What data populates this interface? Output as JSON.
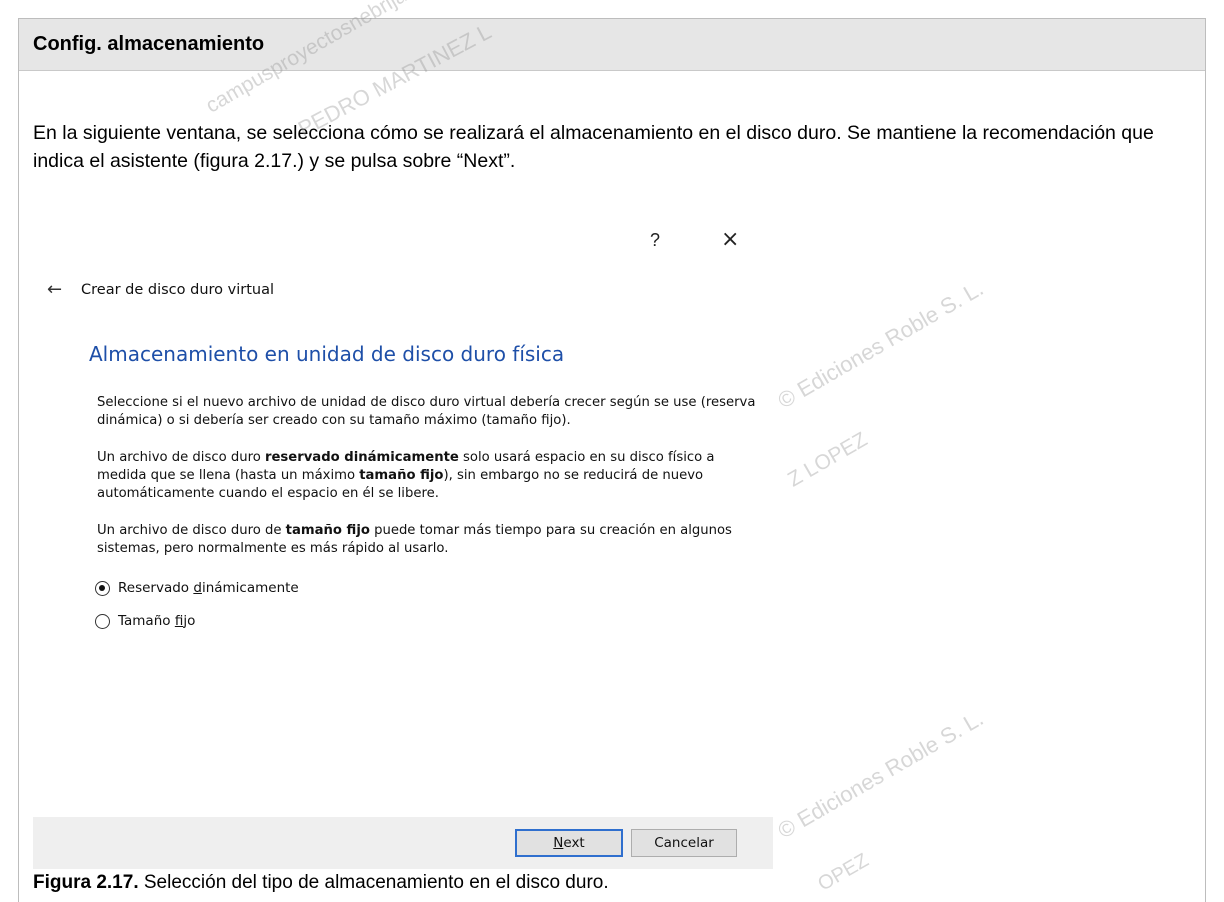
{
  "section": {
    "title": "Config. almacenamiento"
  },
  "intro": {
    "text": "En la siguiente ventana, se selecciona cómo se realizará el almacenamiento en el disco duro. Se mantiene la recomendación que indica el asistente (figura 2.17.) y se pulsa sobre “Next”."
  },
  "dialog": {
    "help_glyph": "?",
    "close_glyph": "×",
    "back_glyph": "←",
    "window_title": "Crear de disco duro virtual",
    "heading": "Almacenamiento en unidad de disco duro física",
    "p1": "Seleccione si el nuevo archivo de unidad de disco duro virtual debería crecer según se use (reserva dinámica) o si debería ser creado con su tamaño máximo (tamaño fijo).",
    "p2": {
      "a": "Un archivo de disco duro ",
      "b": "reservado dinámicamente",
      "c": " solo usará espacio en su disco físico a medida que se llena (hasta un máximo ",
      "d": "tamaño fijo",
      "e": "), sin embargo no se reducirá de nuevo automáticamente cuando el espacio en él se libere."
    },
    "p3": {
      "a": "Un archivo de disco duro de ",
      "b": "tamaño fijo",
      "c": " puede tomar más tiempo para su creación en algunos sistemas, pero normalmente es más rápido al usarlo."
    },
    "options": [
      {
        "pre": "Reservado ",
        "mnemonic": "d",
        "post": "inámicamente",
        "selected": true
      },
      {
        "pre": "Tamaño ",
        "mnemonic": "f",
        "post": "ijo",
        "selected": false
      }
    ],
    "next_mnemonic": "N",
    "next_rest": "ext",
    "cancel_label": "Cancelar"
  },
  "caption": {
    "label": "Figura 2.17.",
    "text": " Selección del tipo de almacenamiento en el disco duro."
  },
  "watermarks": [
    "campusproyectosnebrija",
    "PEDRO MARTINEZ L",
    "© Ediciones Roble S. L.",
    "Z LOPEZ",
    "© Ediciones Roble S. L.",
    "OPEZ"
  ]
}
